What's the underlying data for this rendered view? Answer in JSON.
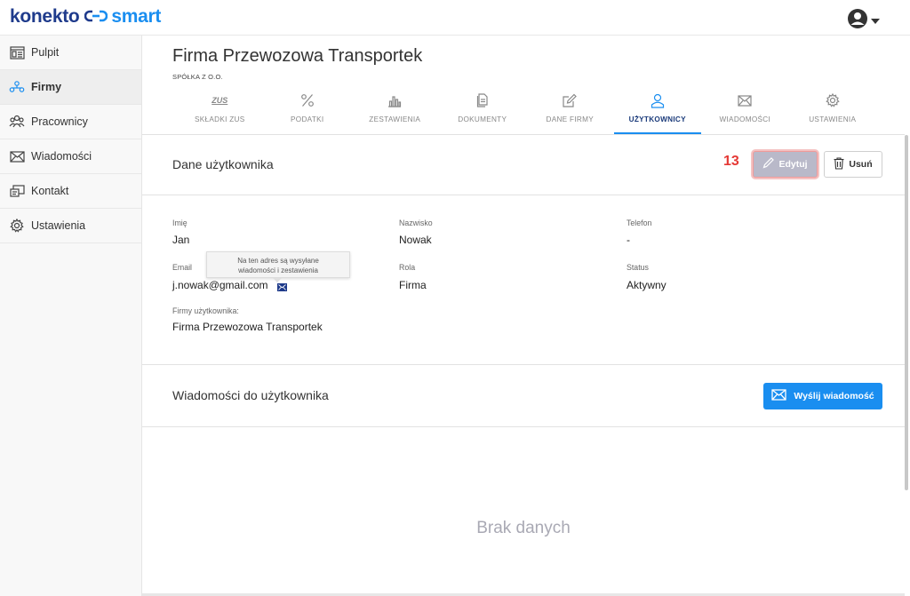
{
  "brand": {
    "name": "konekto",
    "product": "smart"
  },
  "sidebar": {
    "items": [
      {
        "label": "Pulpit",
        "icon": "dashboard-icon"
      },
      {
        "label": "Firmy",
        "icon": "companies-icon",
        "active": true
      },
      {
        "label": "Pracownicy",
        "icon": "employees-icon"
      },
      {
        "label": "Wiadomości",
        "icon": "envelope-icon"
      },
      {
        "label": "Kontakt",
        "icon": "contact-icon"
      },
      {
        "label": "Ustawienia",
        "icon": "gear-icon"
      }
    ]
  },
  "company": {
    "name": "Firma Przewozowa Transportek",
    "type": "SPÓŁKA Z O.O."
  },
  "tabs": [
    {
      "label": "SKŁADKI ZUS",
      "icon": "zus-icon",
      "icon_text": "ZUS"
    },
    {
      "label": "PODATKI",
      "icon": "percent-icon"
    },
    {
      "label": "ZESTAWIENIA",
      "icon": "bar-chart-icon"
    },
    {
      "label": "DOKUMENTY",
      "icon": "documents-icon"
    },
    {
      "label": "DANE FIRMY",
      "icon": "edit-icon"
    },
    {
      "label": "UŻYTKOWNICY",
      "icon": "user-icon",
      "active": true
    },
    {
      "label": "WIADOMOŚCI",
      "icon": "envelope-icon"
    },
    {
      "label": "USTAWIENIA",
      "icon": "gear-icon"
    }
  ],
  "user_details": {
    "title": "Dane użytkownika",
    "step_badge": "13",
    "edit_label": "Edytuj",
    "delete_label": "Usuń",
    "fields": {
      "first_name": {
        "label": "Imię",
        "value": "Jan"
      },
      "last_name": {
        "label": "Nazwisko",
        "value": "Nowak"
      },
      "phone": {
        "label": "Telefon",
        "value": "-"
      },
      "email": {
        "label": "Email",
        "value": "j.nowak@gmail.com"
      },
      "role": {
        "label": "Rola",
        "value": "Firma"
      },
      "status": {
        "label": "Status",
        "value": "Aktywny"
      },
      "companies": {
        "label": "Firmy użytkownika:",
        "value": "Firma Przewozowa Transportek"
      }
    },
    "email_tooltip": {
      "line1": "Na ten adres są wysyłane",
      "line2": "wiadomości i zestawienia"
    }
  },
  "messages": {
    "title": "Wiadomości do użytkownika",
    "send_label": "Wyślij wiadomość",
    "empty_text": "Brak danych"
  },
  "colors": {
    "accent": "#1a8ef0",
    "brand_dark": "#1f3b8c",
    "badge": "#e53935",
    "edit_disabled": "#b9b9c9"
  }
}
